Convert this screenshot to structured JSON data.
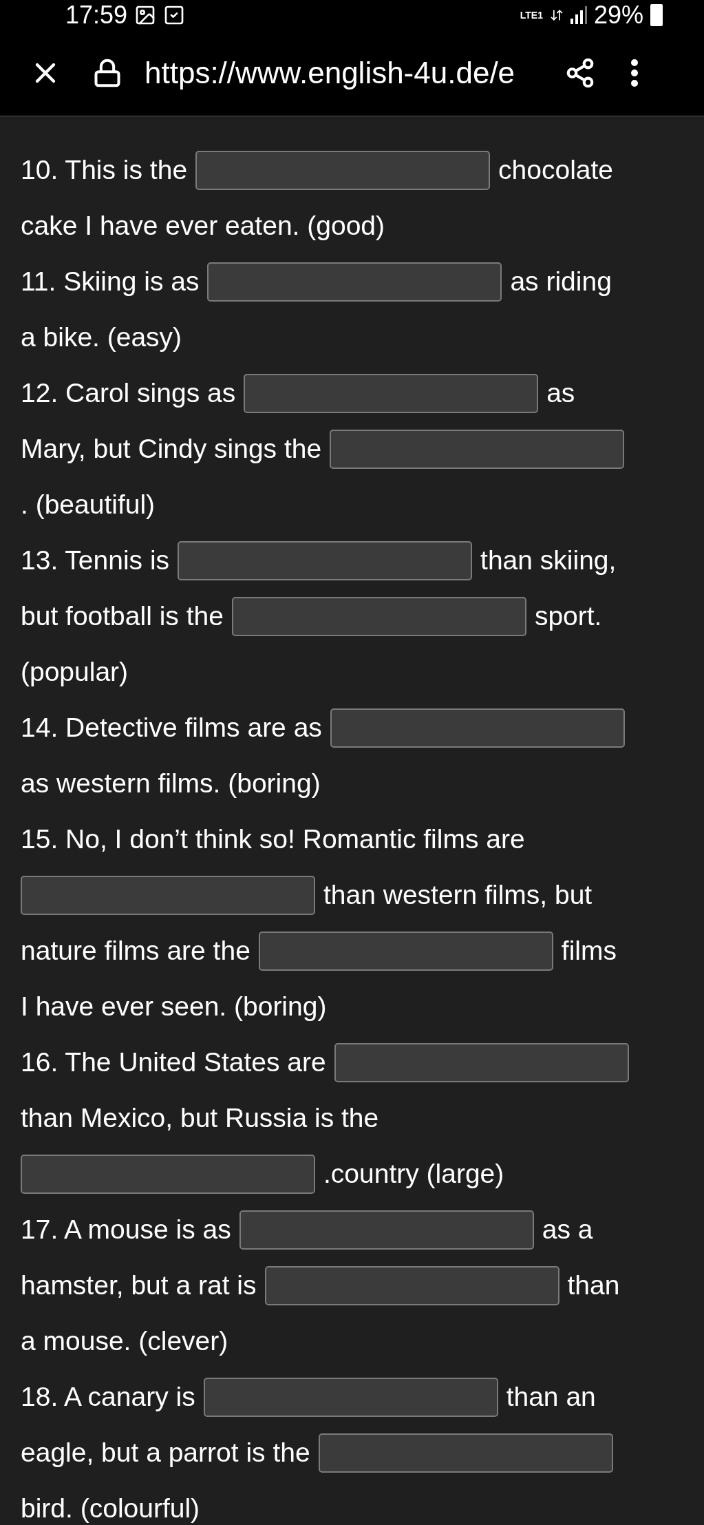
{
  "status_bar": {
    "time": "17:59",
    "network": "LTE1",
    "battery": "29%"
  },
  "browser_bar": {
    "url": "https://www.english-4u.de/e"
  },
  "exercises": [
    {
      "lines": [
        [
          {
            "kind": "text",
            "text": "10. This is the"
          },
          {
            "kind": "blank"
          },
          {
            "kind": "text",
            "text": "chocolate"
          }
        ],
        [
          {
            "kind": "text",
            "text": "cake I have ever eaten. (good)"
          }
        ]
      ]
    },
    {
      "lines": [
        [
          {
            "kind": "text",
            "text": "11. Skiing is as"
          },
          {
            "kind": "blank"
          },
          {
            "kind": "text",
            "text": "as riding"
          }
        ],
        [
          {
            "kind": "text",
            "text": "a bike. (easy)"
          }
        ]
      ]
    },
    {
      "lines": [
        [
          {
            "kind": "text",
            "text": "12. Carol sings as"
          },
          {
            "kind": "blank"
          },
          {
            "kind": "text",
            "text": "as"
          }
        ],
        [
          {
            "kind": "text",
            "text": "Mary, but Cindy sings the"
          },
          {
            "kind": "blank"
          }
        ],
        [
          {
            "kind": "text",
            "text": ". (beautiful)"
          }
        ]
      ]
    },
    {
      "lines": [
        [
          {
            "kind": "text",
            "text": "13. Tennis is"
          },
          {
            "kind": "blank"
          },
          {
            "kind": "text",
            "text": "than skiing,"
          }
        ],
        [
          {
            "kind": "text",
            "text": "but football is the"
          },
          {
            "kind": "blank"
          },
          {
            "kind": "text",
            "text": "sport."
          }
        ],
        [
          {
            "kind": "text",
            "text": "(popular)"
          }
        ]
      ]
    },
    {
      "lines": [
        [
          {
            "kind": "text",
            "text": "14. Detective films are as"
          },
          {
            "kind": "blank"
          }
        ],
        [
          {
            "kind": "text",
            "text": "as western films. (boring)"
          }
        ]
      ]
    },
    {
      "lines": [
        [
          {
            "kind": "text",
            "text": "15. No, I don’t think so! Romantic films are"
          }
        ],
        [
          {
            "kind": "blank"
          },
          {
            "kind": "text",
            "text": "than western films, but"
          }
        ],
        [
          {
            "kind": "text",
            "text": "nature films are the"
          },
          {
            "kind": "blank"
          },
          {
            "kind": "text",
            "text": "films"
          }
        ],
        [
          {
            "kind": "text",
            "text": "I have ever seen. (boring)"
          }
        ]
      ]
    },
    {
      "lines": [
        [
          {
            "kind": "text",
            "text": "16. The United States are"
          },
          {
            "kind": "blank"
          }
        ],
        [
          {
            "kind": "text",
            "text": "than Mexico, but Russia is the"
          }
        ],
        [
          {
            "kind": "blank"
          },
          {
            "kind": "text",
            "text": ".country (large)"
          }
        ]
      ]
    },
    {
      "lines": [
        [
          {
            "kind": "text",
            "text": "17. A mouse is as"
          },
          {
            "kind": "blank"
          },
          {
            "kind": "text",
            "text": "as a"
          }
        ],
        [
          {
            "kind": "text",
            "text": "hamster, but a rat is"
          },
          {
            "kind": "blank"
          },
          {
            "kind": "text",
            "text": "than"
          }
        ],
        [
          {
            "kind": "text",
            "text": "a mouse. (clever)"
          }
        ]
      ]
    },
    {
      "lines": [
        [
          {
            "kind": "text",
            "text": "18. A canary is"
          },
          {
            "kind": "blank"
          },
          {
            "kind": "text",
            "text": "than an"
          }
        ],
        [
          {
            "kind": "text",
            "text": "eagle, but a parrot is the"
          },
          {
            "kind": "blank"
          }
        ],
        [
          {
            "kind": "text",
            "text": "bird. (colourful)"
          }
        ]
      ]
    }
  ]
}
